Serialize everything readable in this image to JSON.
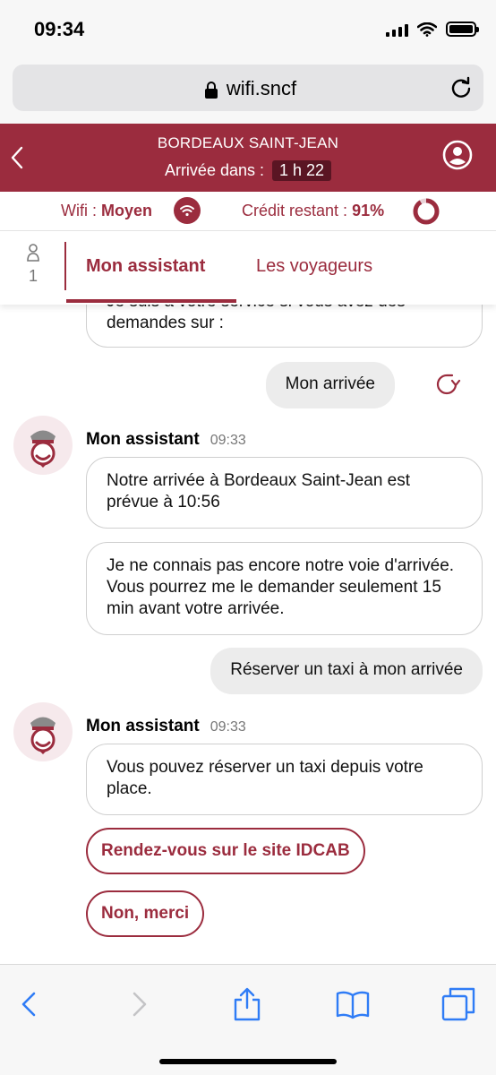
{
  "status_bar": {
    "time": "09:34"
  },
  "browser": {
    "url": "wifi.sncf"
  },
  "header": {
    "station": "BORDEAUX SAINT-JEAN",
    "arrival_label": "Arrivée dans :",
    "arrival_value": "1 h 22"
  },
  "info": {
    "wifi_label": "Wifi :",
    "wifi_value": "Moyen",
    "credit_label": "Crédit restant :",
    "credit_value": "91%"
  },
  "tabs": {
    "people_count": "1",
    "active": "Mon assistant",
    "other": "Les voyageurs"
  },
  "chat": {
    "top_bubble": "Je suis à votre service si vous avez des demandes sur :",
    "user_msg_1": "Mon arrivée",
    "assistant_name": "Mon assistant",
    "msg_time_1": "09:33",
    "assistant_msg_1": "Notre arrivée à Bordeaux Saint-Jean est prévue à 10:56",
    "assistant_msg_2": "Je ne connais pas encore notre voie d'arrivée. Vous pourrez me le demander seulement 15 min avant votre arrivée.",
    "user_msg_2": "Réserver un taxi à mon arrivée",
    "msg_time_2": "09:33",
    "assistant_msg_3": "Vous pouvez réserver un taxi depuis votre place.",
    "action_1": "Rendez-vous sur le site IDCAB",
    "action_2": "Non, merci"
  },
  "colors": {
    "brand": "#9b2c3e",
    "brand_dark": "#5a1523",
    "bubble_gray": "#ececec",
    "ios_blue": "#2f7cf6"
  },
  "icons": [
    "lock-icon",
    "reload-icon",
    "back-icon",
    "user-profile-icon",
    "wifi-icon",
    "credit-ring-icon",
    "person-icon",
    "replay-icon",
    "assistant-avatar-icon",
    "share-icon",
    "bookmarks-icon",
    "tabs-icon",
    "forward-icon"
  ]
}
